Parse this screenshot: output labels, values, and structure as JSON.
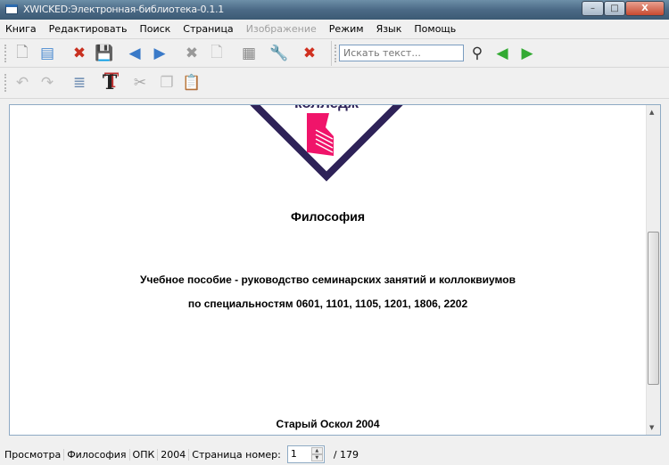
{
  "window": {
    "title": "XWICKED:Электронная-библиотека-0.1.1",
    "minimize": "–",
    "maximize": "□",
    "close": "X"
  },
  "menu": [
    "Книга",
    "Редактировать",
    "Поиск",
    "Страница",
    "Изображение",
    "Режим",
    "Язык",
    "Помощь"
  ],
  "menu_disabled": [
    "Изображение"
  ],
  "toolbar1": [
    {
      "name": "new-document-icon",
      "glyph": "🗋",
      "color": "#999"
    },
    {
      "name": "print-icon",
      "glyph": "▤",
      "color": "#4a8ad0"
    },
    {
      "name": "stop-icon",
      "glyph": "✖",
      "color": "#c83020"
    },
    {
      "name": "save-icon",
      "glyph": "💾",
      "color": "#777"
    },
    {
      "name": "back-arrow-icon",
      "glyph": "◀",
      "color": "#3a7ac8"
    },
    {
      "name": "forward-arrow-icon",
      "glyph": "▶",
      "color": "#3a7ac8"
    },
    {
      "name": "delete-icon",
      "glyph": "✖",
      "color": "#999"
    },
    {
      "name": "page-icon",
      "glyph": "🗋",
      "color": "#bbb"
    },
    {
      "name": "image-icon",
      "glyph": "▦",
      "color": "#888"
    },
    {
      "name": "wrench-icon",
      "glyph": "🔧",
      "color": "#999"
    },
    {
      "name": "close-red-icon",
      "glyph": "✖",
      "color": "#d03020"
    }
  ],
  "search": {
    "placeholder": "Искать текст..."
  },
  "toolbar2": [
    {
      "name": "undo-icon",
      "glyph": "↶",
      "color": "#bbb"
    },
    {
      "name": "redo-icon",
      "glyph": "↷",
      "color": "#bbb"
    },
    {
      "name": "text-document-icon",
      "glyph": "≣",
      "color": "#6a8ab0"
    },
    {
      "name": "font-icon",
      "glyph": "T",
      "color": "#222"
    },
    {
      "name": "cut-icon",
      "glyph": "✂",
      "color": "#aaa"
    },
    {
      "name": "copy-icon",
      "glyph": "❐",
      "color": "#bbb"
    },
    {
      "name": "paste-icon",
      "glyph": "📋",
      "color": "#bbb"
    }
  ],
  "document": {
    "logo_text": "колледж",
    "title": "Философия",
    "line1": "Учебное пособие - руководство семинарских занятий и коллоквиумов",
    "line2": "по специальностям 0601, 1101, 1105, 1201, 1806, 2202",
    "city_year": "Старый Оскол 2004",
    "scroll_position": 0.75
  },
  "status": {
    "mode": "Просмотра",
    "book": "Философия",
    "author": "ОПК",
    "year": "2004",
    "page_label": "Страница номер:",
    "page_value": "1",
    "total": "/ 179"
  }
}
